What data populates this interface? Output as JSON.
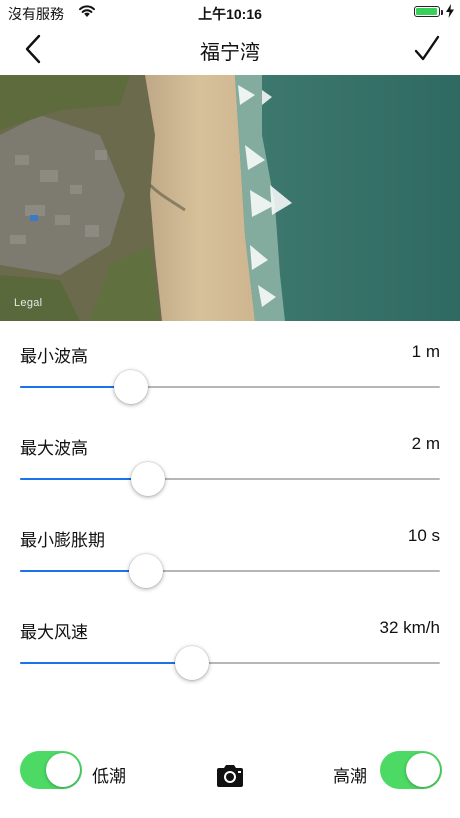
{
  "status_bar": {
    "carrier": "沒有服務",
    "time": "上午10:16",
    "battery_level": 0.95,
    "wifi_icon": "wifi-icon",
    "charging_icon": "charging-bolt-icon"
  },
  "nav": {
    "title": "福宁湾",
    "back_icon": "chevron-left-icon",
    "done_icon": "checkmark-icon"
  },
  "map": {
    "legal": "Legal"
  },
  "sliders": [
    {
      "label": "最小波高",
      "value": "1 m",
      "position": 0.265
    },
    {
      "label": "最大波高",
      "value": "2 m",
      "position": 0.305
    },
    {
      "label": "最小膨胀期",
      "value": "10 s",
      "position": 0.3
    },
    {
      "label": "最大风速",
      "value": "32 km/h",
      "position": 0.41
    }
  ],
  "bottom": {
    "low_tide_label": "低潮",
    "low_tide_on": true,
    "high_tide_label": "高潮",
    "high_tide_on": true,
    "camera_icon": "camera-icon"
  },
  "colors": {
    "accent": "#1a73e8",
    "toggle_on": "#4cd964",
    "track": "#b6b6b6"
  }
}
